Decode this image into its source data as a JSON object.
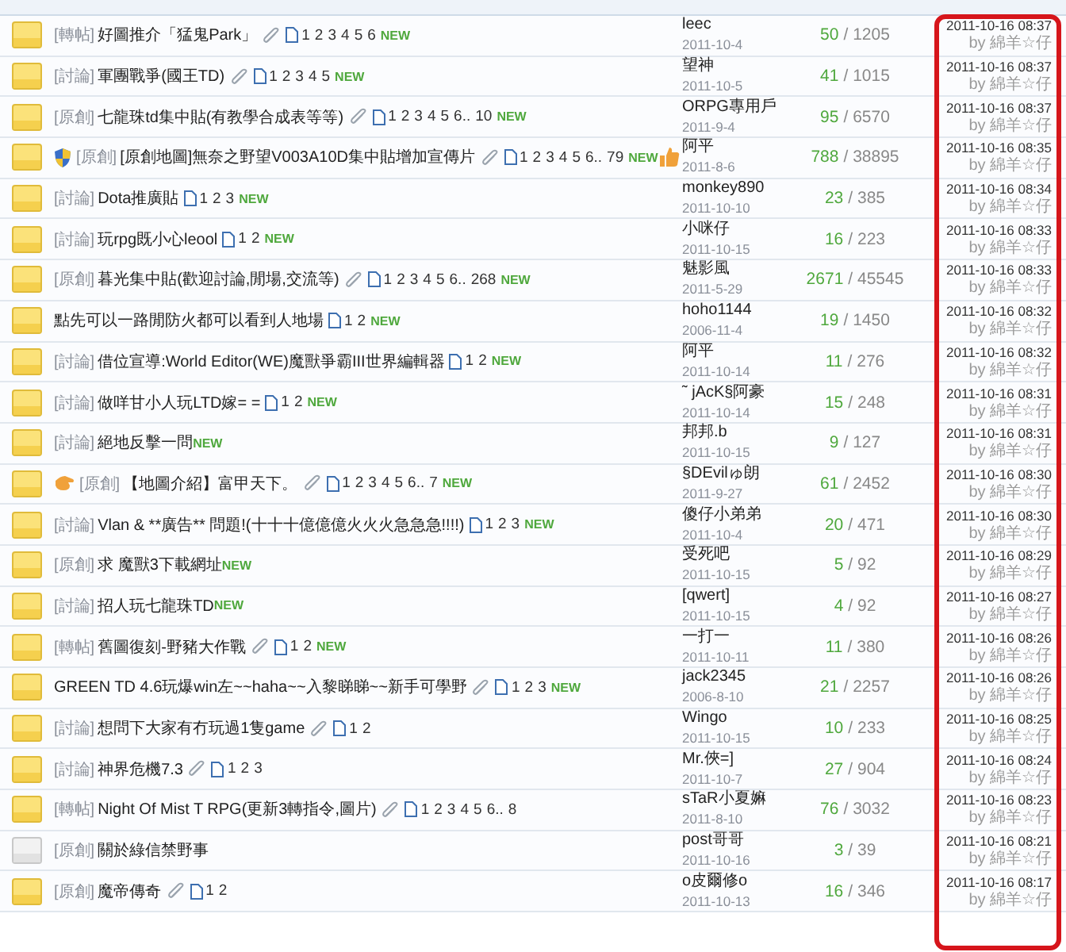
{
  "last_post_highlighted": true,
  "threads": [
    {
      "unread": true,
      "tag": "[轉帖]",
      "title": "好圖推介「猛鬼Park」",
      "attachment": true,
      "pages": [
        "1",
        "2",
        "3",
        "4",
        "5",
        "6"
      ],
      "new_tag": "NEW",
      "recommended": false,
      "author": "leec",
      "joined": "2011-10-4",
      "replies": "50",
      "views": "/ 1205",
      "last_time": "2011-10-16 08:37",
      "last_by": "by 綿羊☆仔"
    },
    {
      "unread": true,
      "tag": "[討論]",
      "title": "軍團戰爭(國王TD)",
      "attachment": true,
      "pages": [
        "1",
        "2",
        "3",
        "4",
        "5"
      ],
      "new_tag": "NEW",
      "recommended": false,
      "author": "望神",
      "joined": "2011-10-5",
      "replies": "41",
      "views": "/ 1015",
      "last_time": "2011-10-16 08:37",
      "last_by": "by 綿羊☆仔"
    },
    {
      "unread": true,
      "tag": "[原創]",
      "title": "七龍珠td集中貼(有教學合成表等等)",
      "attachment": true,
      "pages": [
        "1",
        "2",
        "3",
        "4",
        "5",
        "6..",
        "10"
      ],
      "new_tag": "NEW",
      "recommended": false,
      "author": "ORPG專用戶",
      "joined": "2011-9-4",
      "replies": "95",
      "views": "/ 6570",
      "last_time": "2011-10-16 08:37",
      "last_by": "by 綿羊☆仔"
    },
    {
      "unread": true,
      "kind": "shield",
      "tag": "[原創]",
      "title": "[原創地圖]無奈之野望V003A10D集中貼增加宣傳片",
      "attachment": true,
      "pages": [
        "1",
        "2",
        "3",
        "4",
        "5",
        "6..",
        "79"
      ],
      "new_tag": "NEW",
      "recommended": true,
      "author": "阿平",
      "joined": "2011-8-6",
      "replies": "788",
      "views": "/ 38895",
      "last_time": "2011-10-16 08:35",
      "last_by": "by 綿羊☆仔"
    },
    {
      "unread": true,
      "tag": "[討論]",
      "title": "Dota推廣貼",
      "attachment": false,
      "pages": [
        "1",
        "2",
        "3"
      ],
      "new_tag": "NEW",
      "recommended": false,
      "author": "monkey890",
      "joined": "2011-10-10",
      "replies": "23",
      "views": "/ 385",
      "last_time": "2011-10-16 08:34",
      "last_by": "by 綿羊☆仔"
    },
    {
      "unread": true,
      "tag": "[討論]",
      "title": "玩rpg既小心leool",
      "attachment": false,
      "pages": [
        "1",
        "2"
      ],
      "new_tag": "NEW",
      "recommended": false,
      "author": "小咪仔",
      "joined": "2011-10-15",
      "replies": "16",
      "views": "/ 223",
      "last_time": "2011-10-16 08:33",
      "last_by": "by 綿羊☆仔"
    },
    {
      "unread": true,
      "tag": "[原創]",
      "title": "暮光集中貼(歡迎討論,閒場,交流等)",
      "attachment": true,
      "pages": [
        "1",
        "2",
        "3",
        "4",
        "5",
        "6..",
        "268"
      ],
      "new_tag": "NEW",
      "recommended": false,
      "author": "魅影風",
      "joined": "2011-5-29",
      "replies": "2671",
      "views": "/ 45545",
      "last_time": "2011-10-16 08:33",
      "last_by": "by 綿羊☆仔"
    },
    {
      "unread": true,
      "title": "點先可以一路閒防火都可以看到人地場",
      "attachment": false,
      "pages": [
        "1",
        "2"
      ],
      "new_tag": "NEW",
      "recommended": false,
      "author": "hoho1144",
      "joined": "2006-11-4",
      "replies": "19",
      "views": "/ 1450",
      "last_time": "2011-10-16 08:32",
      "last_by": "by 綿羊☆仔"
    },
    {
      "unread": true,
      "tag": "[討論]",
      "title": "借位宣導:World Editor(WE)魔獸爭霸III世界編輯器",
      "attachment": false,
      "pages": [
        "1",
        "2"
      ],
      "new_tag": "NEW",
      "recommended": false,
      "author": "阿平",
      "joined": "2011-10-14",
      "replies": "11",
      "views": "/ 276",
      "last_time": "2011-10-16 08:32",
      "last_by": "by 綿羊☆仔"
    },
    {
      "unread": true,
      "tag": "[討論]",
      "title": "做咩甘小人玩LTD嫁= =",
      "attachment": false,
      "pages": [
        "1",
        "2"
      ],
      "new_tag": "NEW",
      "recommended": false,
      "author": "˜ jAcK§阿豪",
      "joined": "2011-10-14",
      "replies": "15",
      "views": "/ 248",
      "last_time": "2011-10-16 08:31",
      "last_by": "by 綿羊☆仔"
    },
    {
      "unread": true,
      "tag": "[討論]",
      "title": "絕地反擊一問",
      "attachment": false,
      "new_tag": "NEW",
      "recommended": false,
      "author": "邦邦.b",
      "joined": "2011-10-15",
      "replies": "9",
      "views": "/ 127",
      "last_time": "2011-10-16 08:31",
      "last_by": "by 綿羊☆仔"
    },
    {
      "unread": true,
      "kind": "hand",
      "tag": "[原創]",
      "title": "【地圖介紹】富甲天下。",
      "attachment": true,
      "pages": [
        "1",
        "2",
        "3",
        "4",
        "5",
        "6..",
        "7"
      ],
      "new_tag": "NEW",
      "recommended": false,
      "author": "§DEvilゅ朗",
      "joined": "2011-9-27",
      "replies": "61",
      "views": "/ 2452",
      "last_time": "2011-10-16 08:30",
      "last_by": "by 綿羊☆仔"
    },
    {
      "unread": true,
      "tag": "[討論]",
      "title": "Vlan & **廣告** 問題!(十十十億億億火火火急急急!!!!)",
      "attachment": false,
      "pages": [
        "1",
        "2",
        "3"
      ],
      "new_tag": "NEW",
      "recommended": false,
      "author": "傻仔小弟弟",
      "joined": "2011-10-4",
      "replies": "20",
      "views": "/ 471",
      "last_time": "2011-10-16 08:30",
      "last_by": "by 綿羊☆仔"
    },
    {
      "unread": true,
      "tag": "[原創]",
      "title": "求 魔獸3下載網址",
      "attachment": false,
      "new_tag": "NEW",
      "recommended": false,
      "author": "受死吧",
      "joined": "2011-10-15",
      "replies": "5",
      "views": "/ 92",
      "last_time": "2011-10-16 08:29",
      "last_by": "by 綿羊☆仔"
    },
    {
      "unread": true,
      "tag": "[討論]",
      "title": "招人玩七龍珠TD",
      "attachment": false,
      "new_tag": "NEW",
      "recommended": false,
      "author": "[qwert]",
      "joined": "2011-10-15",
      "replies": "4",
      "views": "/ 92",
      "last_time": "2011-10-16 08:27",
      "last_by": "by 綿羊☆仔"
    },
    {
      "unread": true,
      "tag": "[轉帖]",
      "title": "舊圖復刻-野豬大作戰",
      "attachment": true,
      "pages": [
        "1",
        "2"
      ],
      "new_tag": "NEW",
      "recommended": false,
      "author": "一打一",
      "joined": "2011-10-11",
      "replies": "11",
      "views": "/ 380",
      "last_time": "2011-10-16 08:26",
      "last_by": "by 綿羊☆仔"
    },
    {
      "unread": true,
      "title": "GREEN TD 4.6玩爆win左~~haha~~入黎睇睇~~新手可學野",
      "attachment": true,
      "pages": [
        "1",
        "2",
        "3"
      ],
      "new_tag": "NEW",
      "recommended": false,
      "author": "jack2345",
      "joined": "2006-8-10",
      "replies": "21",
      "views": "/ 2257",
      "last_time": "2011-10-16 08:26",
      "last_by": "by 綿羊☆仔"
    },
    {
      "unread": true,
      "tag": "[討論]",
      "title": "想問下大家有冇玩過1隻game",
      "attachment": true,
      "pages": [
        "1",
        "2"
      ],
      "recommended": false,
      "author": "Wingo",
      "joined": "2011-10-15",
      "replies": "10",
      "views": "/ 233",
      "last_time": "2011-10-16 08:25",
      "last_by": "by 綿羊☆仔"
    },
    {
      "unread": true,
      "tag": "[討論]",
      "title": "神界危機7.3",
      "attachment": true,
      "pages": [
        "1",
        "2",
        "3"
      ],
      "recommended": false,
      "author": "Mr.俠=]",
      "joined": "2011-10-7",
      "replies": "27",
      "views": "/ 904",
      "last_time": "2011-10-16 08:24",
      "last_by": "by 綿羊☆仔"
    },
    {
      "unread": true,
      "tag": "[轉帖]",
      "title": "Night Of Mist T RPG(更新3轉指令,圖片)",
      "attachment": true,
      "pages": [
        "1",
        "2",
        "3",
        "4",
        "5",
        "6..",
        "8"
      ],
      "recommended": false,
      "author": "sTaR小夏嫲",
      "joined": "2011-8-10",
      "replies": "76",
      "views": "/ 3032",
      "last_time": "2011-10-16 08:23",
      "last_by": "by 綿羊☆仔"
    },
    {
      "unread": false,
      "tag": "[原創]",
      "title": "關於綠信禁野事",
      "attachment": false,
      "recommended": false,
      "author": "post哥哥",
      "joined": "2011-10-16",
      "replies": "3",
      "views": "/ 39",
      "last_time": "2011-10-16 08:21",
      "last_by": "by 綿羊☆仔"
    },
    {
      "unread": true,
      "tag": "[原創]",
      "title": "魔帝傳奇",
      "attachment": true,
      "pages": [
        "1",
        "2"
      ],
      "recommended": false,
      "author": "o皮爾修o",
      "joined": "2011-10-13",
      "replies": "16",
      "views": "/ 346",
      "last_time": "2011-10-16 08:17",
      "last_by": "by 綿羊☆仔"
    }
  ]
}
